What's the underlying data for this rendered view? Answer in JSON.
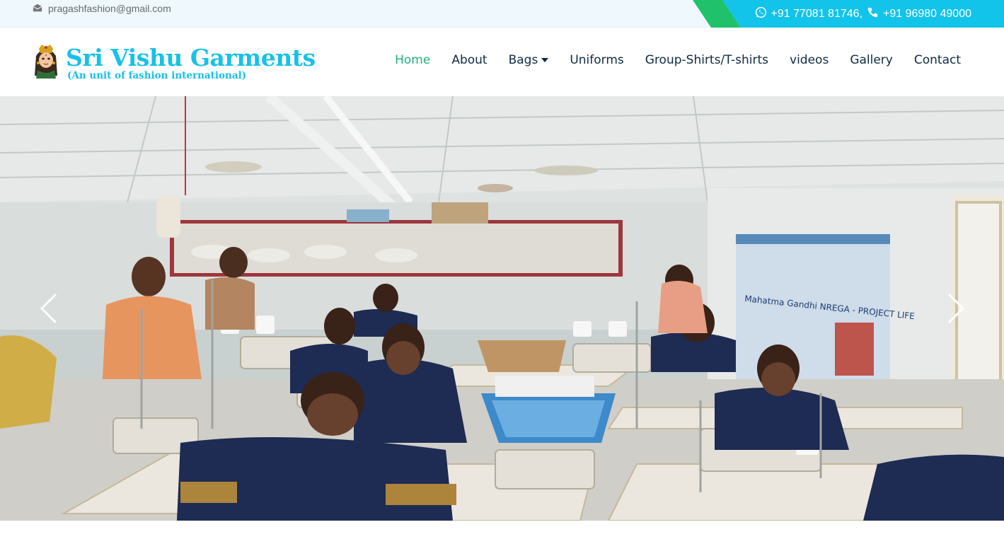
{
  "topbar": {
    "email": "pragashfashion@gmail.com",
    "phones": "+91 77081 81746, ",
    "phone2": "+91 96980 49000"
  },
  "brand": {
    "name": "Sri Vishu Garments",
    "tagline": "(An unit of fashion international)"
  },
  "nav": {
    "items": [
      "Home",
      "About",
      "Bags",
      "Uniforms",
      "Group-Shirts/T-shirts",
      "videos",
      "Gallery",
      "Contact"
    ],
    "active": "Home"
  },
  "hero": {
    "banner_text": "Mahatma Gandhi NREGA - PROJECT LIFE"
  },
  "colors": {
    "accent_cyan": "#12c3ea",
    "accent_green": "#1fc26a",
    "nav_text": "#0f2a44",
    "nav_active": "#1fb57a"
  },
  "icons": [
    "envelope-icon",
    "whatsapp-icon",
    "phone-icon",
    "chevron-left-icon",
    "chevron-right-icon",
    "deity-logo-icon"
  ]
}
